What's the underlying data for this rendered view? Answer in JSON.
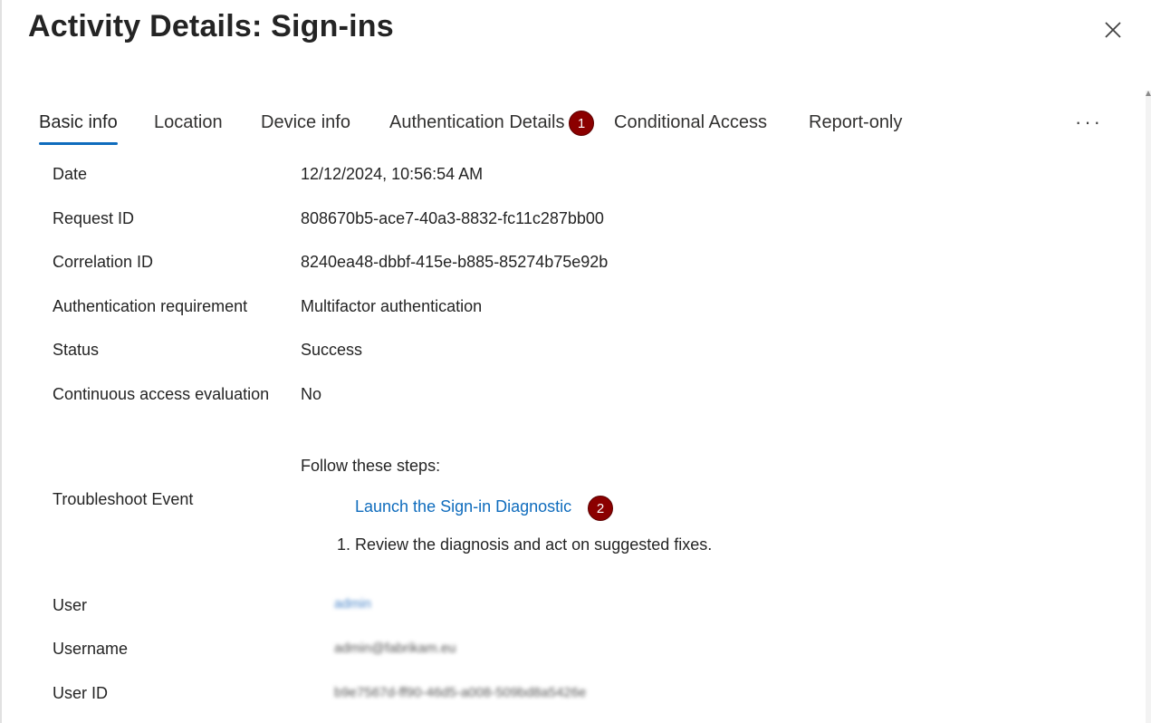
{
  "title": "Activity Details: Sign-ins",
  "tabs": [
    {
      "label": "Basic info"
    },
    {
      "label": "Location"
    },
    {
      "label": "Device info"
    },
    {
      "label": "Authentication Details"
    },
    {
      "label": "Conditional Access"
    },
    {
      "label": "Report-only"
    }
  ],
  "more_label": "···",
  "badges": [
    "1",
    "2"
  ],
  "details": {
    "date": {
      "label": "Date",
      "value": "12/12/2024, 10:56:54 AM"
    },
    "request_id": {
      "label": "Request ID",
      "value": "808670b5-ace7-40a3-8832-fc11c287bb00"
    },
    "correlation_id": {
      "label": "Correlation ID",
      "value": "8240ea48-dbbf-415e-b885-85274b75e92b"
    },
    "auth_requirement": {
      "label": "Authentication requirement",
      "value": "Multifactor authentication"
    },
    "status": {
      "label": "Status",
      "value": "Success"
    },
    "cae": {
      "label": "Continuous access evaluation",
      "value": "No"
    }
  },
  "troubleshoot": {
    "label": "Troubleshoot Event",
    "intro": "Follow these steps:",
    "link": "Launch the Sign-in Diagnostic",
    "step1": "1. Review the diagnosis and act on suggested fixes."
  },
  "user": {
    "user_label": "User",
    "user_value": "admin",
    "username_label": "Username",
    "username_value": "admin@fabrikam.eu",
    "userid_label": "User ID",
    "userid_value": "b9e7567d-ff90-46d5-a008-509bd8a5426e"
  }
}
